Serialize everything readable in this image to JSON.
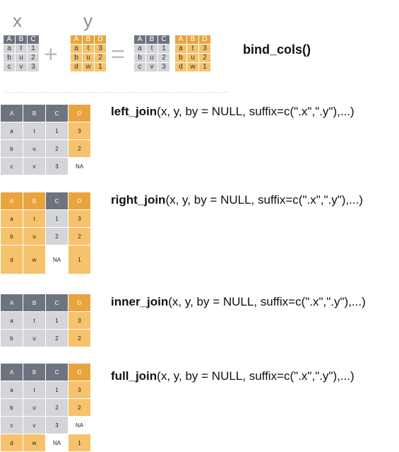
{
  "header": {
    "x_label": "x",
    "y_label": "y",
    "plus": "+",
    "equals": "=",
    "title": "bind_cols()"
  },
  "mini_x": [
    [
      "A",
      "B",
      "C"
    ],
    [
      "a",
      "t",
      "1"
    ],
    [
      "b",
      "u",
      "2"
    ],
    [
      "c",
      "v",
      "3"
    ]
  ],
  "mini_y": [
    [
      "A",
      "B",
      "D"
    ],
    [
      "a",
      "t",
      "3"
    ],
    [
      "b",
      "u",
      "2"
    ],
    [
      "d",
      "w",
      "1"
    ]
  ],
  "mini_xy": [
    [
      "A",
      "B",
      "C",
      "A",
      "B",
      "D"
    ],
    [
      "a",
      "t",
      "1",
      "a",
      "t",
      "3"
    ],
    [
      "b",
      "u",
      "2",
      "b",
      "u",
      "2"
    ],
    [
      "c",
      "v",
      "3",
      "d",
      "w",
      "1"
    ]
  ],
  "joins": [
    {
      "fn": "left_join",
      "args": "(x, y, by = NULL, suffix=c(\".x\",\".y\"),...)",
      "rows": [
        [
          "A",
          "B",
          "C",
          "D"
        ],
        [
          "a",
          "t",
          "1",
          "3"
        ],
        [
          "b",
          "u",
          "2",
          "2"
        ],
        [
          "c",
          "v",
          "3",
          "NA"
        ]
      ],
      "colors": [
        [
          "gh",
          "gh",
          "gh",
          "oh"
        ],
        [
          "gb",
          "gb",
          "gb",
          "ob"
        ],
        [
          "gb",
          "gb",
          "gb",
          "ob"
        ],
        [
          "gb",
          "gb",
          "gb",
          "w"
        ]
      ]
    },
    {
      "fn": "right_join",
      "args": "(x, y, by = NULL, suffix=c(\".x\",\".y\"),...)",
      "rows": [
        [
          "A",
          "B",
          "C",
          "D"
        ],
        [
          "a",
          "t",
          "1",
          "3"
        ],
        [
          "b",
          "u",
          "2",
          "2"
        ],
        [
          "d",
          "w",
          "NA",
          "1"
        ]
      ],
      "colors": [
        [
          "oh",
          "oh",
          "gh",
          "oh"
        ],
        [
          "ob",
          "ob",
          "gb",
          "ob"
        ],
        [
          "ob",
          "ob",
          "gb",
          "ob"
        ],
        [
          "ob",
          "ob",
          "w",
          "ob"
        ]
      ]
    },
    {
      "fn": "inner_join",
      "args": "(x, y, by = NULL, suffix=c(\".x\",\".y\"),...)",
      "rows": [
        [
          "A",
          "B",
          "C",
          "D"
        ],
        [
          "a",
          "t",
          "1",
          "3"
        ],
        [
          "b",
          "u",
          "2",
          "2"
        ]
      ],
      "colors": [
        [
          "gh",
          "gh",
          "gh",
          "oh"
        ],
        [
          "gb",
          "gb",
          "gb",
          "ob"
        ],
        [
          "gb",
          "gb",
          "gb",
          "ob"
        ]
      ]
    },
    {
      "fn": "full_join",
      "args": "(x, y, by = NULL, suffix=c(\".x\",\".y\"),...)",
      "rows": [
        [
          "A",
          "B",
          "C",
          "D"
        ],
        [
          "a",
          "t",
          "1",
          "3"
        ],
        [
          "b",
          "u",
          "2",
          "2"
        ],
        [
          "c",
          "v",
          "3",
          "NA"
        ],
        [
          "d",
          "w",
          "NA",
          "1"
        ]
      ],
      "colors": [
        [
          "gh",
          "gh",
          "gh",
          "oh"
        ],
        [
          "gb",
          "gb",
          "gb",
          "ob"
        ],
        [
          "gb",
          "gb",
          "gb",
          "ob"
        ],
        [
          "gb",
          "gb",
          "gb",
          "w"
        ],
        [
          "ob",
          "ob",
          "w",
          "ob"
        ]
      ]
    }
  ]
}
